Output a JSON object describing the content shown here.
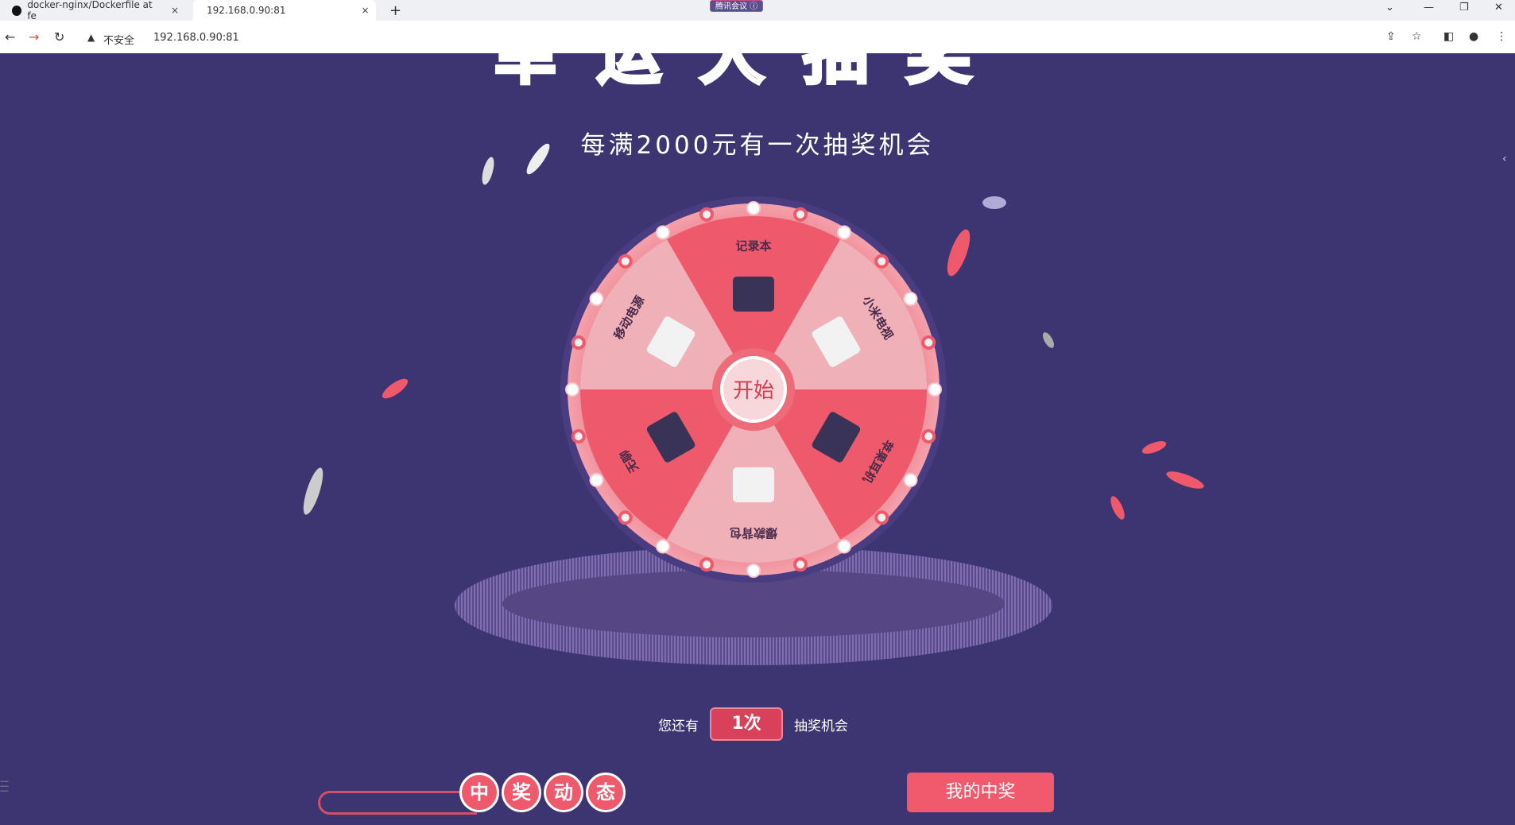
{
  "browser": {
    "tabs": [
      {
        "title": "docker-nginx/Dockerfile at fe",
        "close": "×"
      },
      {
        "title": "192.168.0.90:81",
        "close": "×"
      }
    ],
    "new_tab": "+",
    "meeting_badge": "腾讯会议 ⓘ",
    "security_label": "不安全",
    "url": "192.168.0.90:81"
  },
  "page": {
    "title": "幸运大抽奖",
    "subtitle": "每满2000元有一次抽奖机会",
    "wheel": {
      "start_label": "开始",
      "prizes": [
        "记录本",
        "小米电视",
        "苹果耳机",
        "爆款背包",
        "无聊",
        "移动电源"
      ]
    },
    "remaining": {
      "prefix": "您还有",
      "count": "1次",
      "suffix": "抽奖机会"
    },
    "winners_title": [
      "中",
      "奖",
      "动",
      "态"
    ],
    "my_prize_button": "我的中奖"
  },
  "colors": {
    "background": "#3c3572",
    "accent": "#f15a6d",
    "wheel_light": "#efb0b8",
    "wheel_dark": "#ee5a6b"
  }
}
